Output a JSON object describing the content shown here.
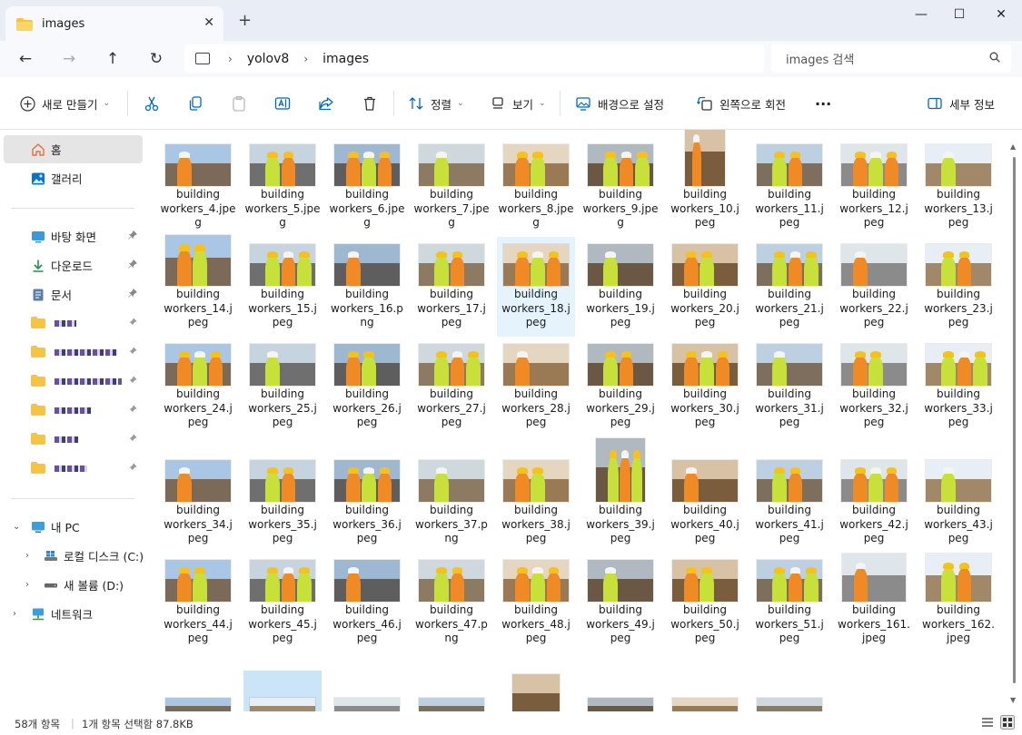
{
  "window": {
    "tab_title": "images",
    "tab_close": "✕",
    "new_tab": "+",
    "minimize": "—",
    "maximize": "☐",
    "close": "✕"
  },
  "nav": {
    "back": "←",
    "forward": "→",
    "up": "↑",
    "refresh": "↻",
    "breadcrumb": [
      "yolov8",
      "images"
    ],
    "chevron": "›",
    "search_placeholder": "images 검색"
  },
  "toolbar": {
    "new_label": "새로 만들기",
    "sort_label": "정렬",
    "view_label": "보기",
    "set_background_label": "배경으로 설정",
    "rotate_left_label": "왼쪽으로 회전",
    "more_label": "···",
    "details_label": "세부 정보",
    "dropdown": "⌄"
  },
  "sidebar": {
    "home": "홈",
    "gallery": "갤러리",
    "pinned": [
      {
        "label": "바탕 화면",
        "icon": "desktop-icon"
      },
      {
        "label": "다운로드",
        "icon": "download-icon"
      },
      {
        "label": "문서",
        "icon": "documents-icon"
      }
    ],
    "this_pc": "내 PC",
    "drives": [
      "로컬 디스크 (C:)",
      "새 볼륨 (D:)"
    ],
    "network": "네트워크",
    "pin_glyph": "📌"
  },
  "files": [
    "building workers_4.jpeg",
    "building workers_5.jpeg",
    "building workers_6.jpeg",
    "building workers_7.jpeg",
    "building workers_8.jpeg",
    "building workers_9.jpeg",
    "building workers_10.jpeg",
    "building workers_11.jpeg",
    "building workers_12.jpeg",
    "building workers_13.jpeg",
    "building workers_14.jpeg",
    "building workers_15.jpeg",
    "building workers_16.png",
    "building workers_17.jpeg",
    "building workers_18.jpeg",
    "building workers_19.jpeg",
    "building workers_20.jpeg",
    "building workers_21.jpeg",
    "building workers_22.jpeg",
    "building workers_23.jpeg",
    "building workers_24.jpeg",
    "building workers_25.jpeg",
    "building workers_26.jpeg",
    "building workers_27.jpeg",
    "building workers_28.jpeg",
    "building workers_29.jpeg",
    "building workers_30.jpeg",
    "building workers_31.jpeg",
    "building workers_32.jpeg",
    "building workers_33.jpeg",
    "building workers_34.jpeg",
    "building workers_35.jpeg",
    "building workers_36.jpeg",
    "building workers_37.png",
    "building workers_38.jpeg",
    "building workers_39.jpeg",
    "building workers_40.jpeg",
    "building workers_41.jpeg",
    "building workers_42.jpeg",
    "building workers_43.jpeg",
    "building workers_44.jpeg",
    "building workers_45.jpeg",
    "building workers_46.jpeg",
    "building workers_47.png",
    "building workers_48.jpeg",
    "building workers_49.jpeg",
    "building workers_50.jpeg",
    "building workers_51.jpeg",
    "building workers_161.jpeg",
    "building workers_162.jpeg"
  ],
  "file_display": [
    [
      "building",
      "workers_4.jpe",
      "g"
    ],
    [
      "building",
      "workers_5.jpe",
      "g"
    ],
    [
      "building",
      "workers_6.jpe",
      "g"
    ],
    [
      "building",
      "workers_7.jpe",
      "g"
    ],
    [
      "building",
      "workers_8.jpe",
      "g"
    ],
    [
      "building",
      "workers_9.jpe",
      "g"
    ],
    [
      "building",
      "workers_10.j",
      "peg"
    ],
    [
      "building",
      "workers_11.j",
      "peg"
    ],
    [
      "building",
      "workers_12.j",
      "peg"
    ],
    [
      "building",
      "workers_13.j",
      "peg"
    ],
    [
      "building",
      "workers_14.j",
      "peg"
    ],
    [
      "building",
      "workers_15.j",
      "peg"
    ],
    [
      "building",
      "workers_16.p",
      "ng"
    ],
    [
      "building",
      "workers_17.j",
      "peg"
    ],
    [
      "building",
      "workers_18.j",
      "peg"
    ],
    [
      "building",
      "workers_19.j",
      "peg"
    ],
    [
      "building",
      "workers_20.j",
      "peg"
    ],
    [
      "building",
      "workers_21.j",
      "peg"
    ],
    [
      "building",
      "workers_22.j",
      "peg"
    ],
    [
      "building",
      "workers_23.j",
      "peg"
    ],
    [
      "building",
      "workers_24.j",
      "peg"
    ],
    [
      "building",
      "workers_25.j",
      "peg"
    ],
    [
      "building",
      "workers_26.j",
      "peg"
    ],
    [
      "building",
      "workers_27.j",
      "peg"
    ],
    [
      "building",
      "workers_28.j",
      "peg"
    ],
    [
      "building",
      "workers_29.j",
      "peg"
    ],
    [
      "building",
      "workers_30.j",
      "peg"
    ],
    [
      "building",
      "workers_31.j",
      "peg"
    ],
    [
      "building",
      "workers_32.j",
      "peg"
    ],
    [
      "building",
      "workers_33.j",
      "peg"
    ],
    [
      "building",
      "workers_34.j",
      "peg"
    ],
    [
      "building",
      "workers_35.j",
      "peg"
    ],
    [
      "building",
      "workers_36.j",
      "peg"
    ],
    [
      "building",
      "workers_37.p",
      "ng"
    ],
    [
      "building",
      "workers_38.j",
      "peg"
    ],
    [
      "building",
      "workers_39.j",
      "peg"
    ],
    [
      "building",
      "workers_40.j",
      "peg"
    ],
    [
      "building",
      "workers_41.j",
      "peg"
    ],
    [
      "building",
      "workers_42.j",
      "peg"
    ],
    [
      "building",
      "workers_43.j",
      "peg"
    ],
    [
      "building",
      "workers_44.j",
      "peg"
    ],
    [
      "building",
      "workers_45.j",
      "peg"
    ],
    [
      "building",
      "workers_46.j",
      "peg"
    ],
    [
      "building",
      "workers_47.p",
      "ng"
    ],
    [
      "building",
      "workers_48.j",
      "peg"
    ],
    [
      "building",
      "workers_49.j",
      "peg"
    ],
    [
      "building",
      "workers_50.j",
      "peg"
    ],
    [
      "building",
      "workers_51.j",
      "peg"
    ],
    [
      "building",
      "workers_161.",
      "jpeg"
    ],
    [
      "building",
      "workers_162.",
      "jpeg"
    ]
  ],
  "hovered_file": "building workers_18.jpeg",
  "selected_partial_index": 1,
  "status": {
    "item_count": "58개 항목",
    "selection": "1개 항목 선택함 87.8KB"
  },
  "colors": {
    "accent": "#0067c0",
    "selection": "#cce4f7",
    "hover": "#e5f3fd",
    "folder": "#f5c442",
    "hardhat": "#f6c21a",
    "vest": "#c8e03a"
  }
}
